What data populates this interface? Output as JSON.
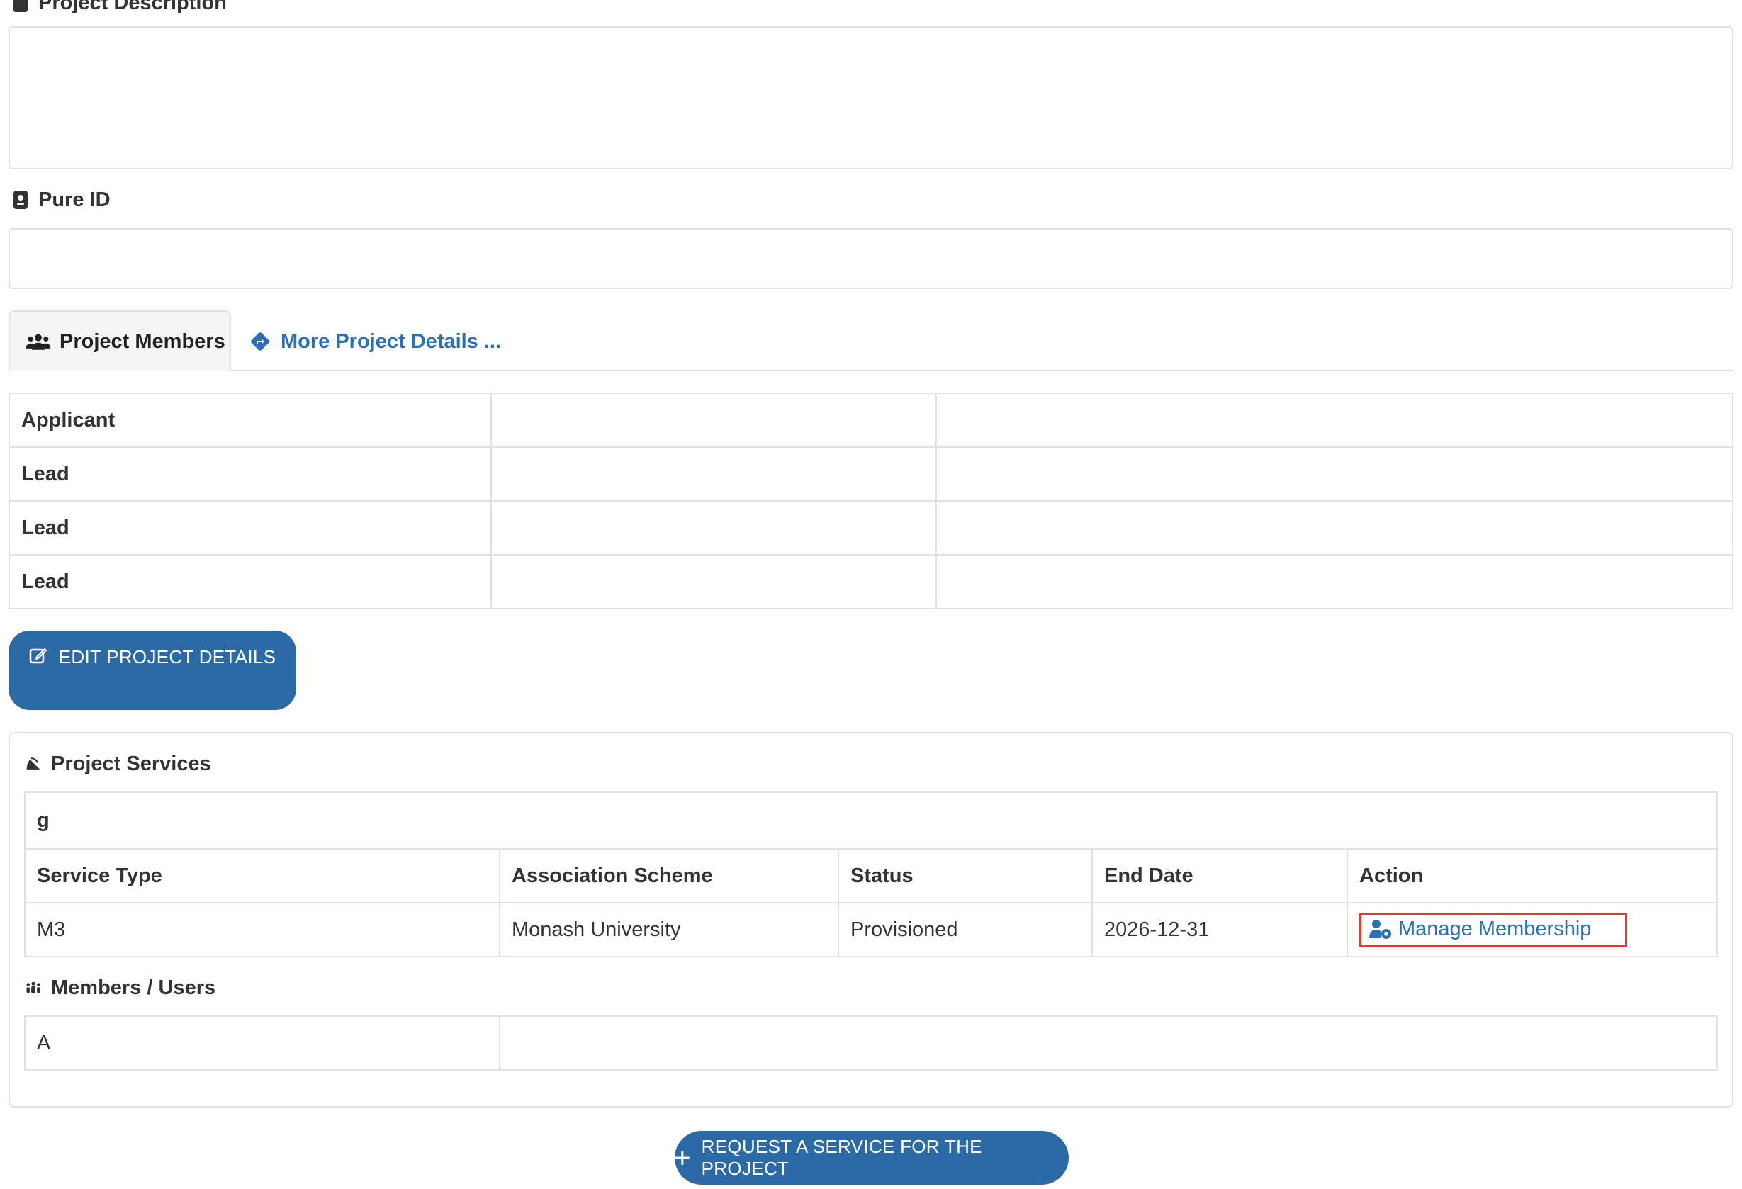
{
  "fields": {
    "description_label": "Project Description",
    "pure_id_label": "Pure ID"
  },
  "tabs": {
    "members_label": "Project Members",
    "more_details_label": "More Project Details ..."
  },
  "members": [
    {
      "role": "Applicant"
    },
    {
      "role": "Lead"
    },
    {
      "role": "Lead"
    },
    {
      "role": "Lead"
    }
  ],
  "buttons": {
    "edit_label": "EDIT PROJECT DETAILS",
    "request_label": "REQUEST A SERVICE FOR THE PROJECT"
  },
  "services": {
    "title": "Project Services",
    "group_name": "g",
    "headers": [
      "Service Type",
      "Association Scheme",
      "Status",
      "End Date",
      "Action"
    ],
    "row": {
      "service_type": "M3",
      "scheme": "Monash University",
      "status": "Provisioned",
      "end_date": "2026-12-31",
      "action_label": "Manage Membership"
    },
    "members_title": "Members / Users",
    "user_first": "A"
  },
  "colors": {
    "primary": "#2c6aa6",
    "link": "#2a6fb8",
    "highlight": "#e23a2a",
    "border": "#e2e2e2"
  }
}
